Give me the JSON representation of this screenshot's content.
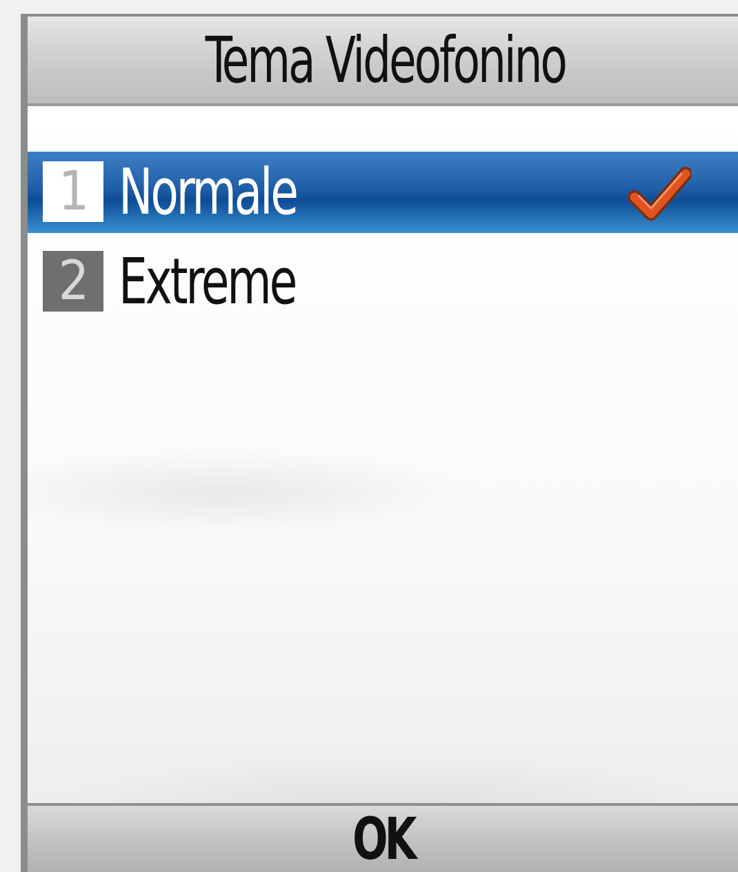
{
  "screen": {
    "title": "Tema Videofonino"
  },
  "options": {
    "items": [
      {
        "number": "1",
        "label": "Normale",
        "selected": true,
        "checked": true
      },
      {
        "number": "2",
        "label": "Extreme",
        "selected": false,
        "checked": false
      }
    ]
  },
  "softkeys": {
    "center_label": "OK"
  },
  "icons": {
    "check": "checkmark-icon"
  },
  "colors": {
    "selection": "#1f5fa8",
    "checkmark": "#e0551f"
  }
}
